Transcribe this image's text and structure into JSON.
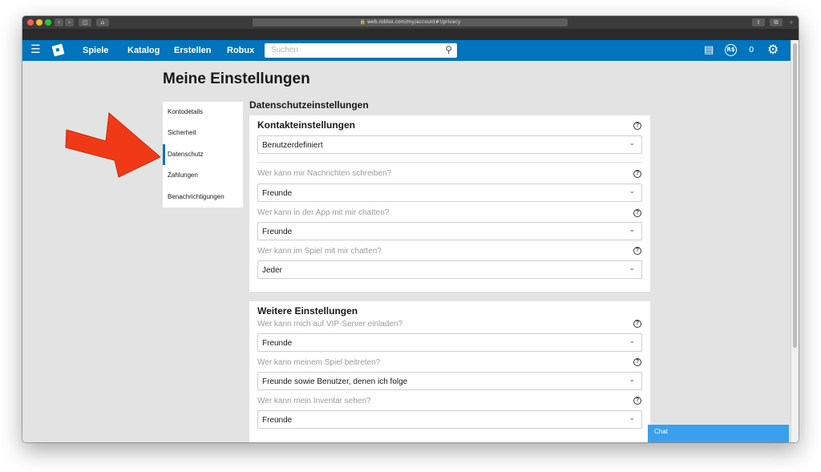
{
  "browser": {
    "url": "web.roblox.com/my/account#!/privacy",
    "lock_icon": "lock-icon"
  },
  "nav": {
    "links": [
      "Spiele",
      "Katalog",
      "Erstellen",
      "Robux"
    ],
    "search_placeholder": "Suchen",
    "robux_count": "0"
  },
  "page": {
    "title": "Meine Einstellungen"
  },
  "sidebar": {
    "items": [
      "Kontodetails",
      "Sicherheit",
      "Datenschutz",
      "Zahlungen",
      "Benachrichtigungen"
    ],
    "active_index": 2
  },
  "privacy": {
    "section_title": "Datenschutzeinstellungen",
    "contact": {
      "title": "Kontakteinstellungen",
      "preset_value": "Benutzerdefiniert",
      "questions": [
        {
          "label": "Wer kann mir Nachrichten schreiben?",
          "value": "Freunde"
        },
        {
          "label": "Wer kann in der App mit mir chatten?",
          "value": "Freunde"
        },
        {
          "label": "Wer kann im Spiel mit mir chatten?",
          "value": "Jeder"
        }
      ]
    },
    "other": {
      "title": "Weitere Einstellungen",
      "questions": [
        {
          "label": "Wer kann mich auf VIP-Server einladen?",
          "value": "Freunde"
        },
        {
          "label": "Wer kann meinem Spiel beitreten?",
          "value": "Freunde sowie Benutzer, denen ich folge"
        },
        {
          "label": "Wer kann mein Inventar sehen?",
          "value": "Freunde"
        }
      ]
    }
  },
  "chat": {
    "label": "Chat"
  },
  "colors": {
    "nav_bar": "#0074bd",
    "arrow": "#f03a17",
    "chat_tab": "#3aa0ed"
  }
}
